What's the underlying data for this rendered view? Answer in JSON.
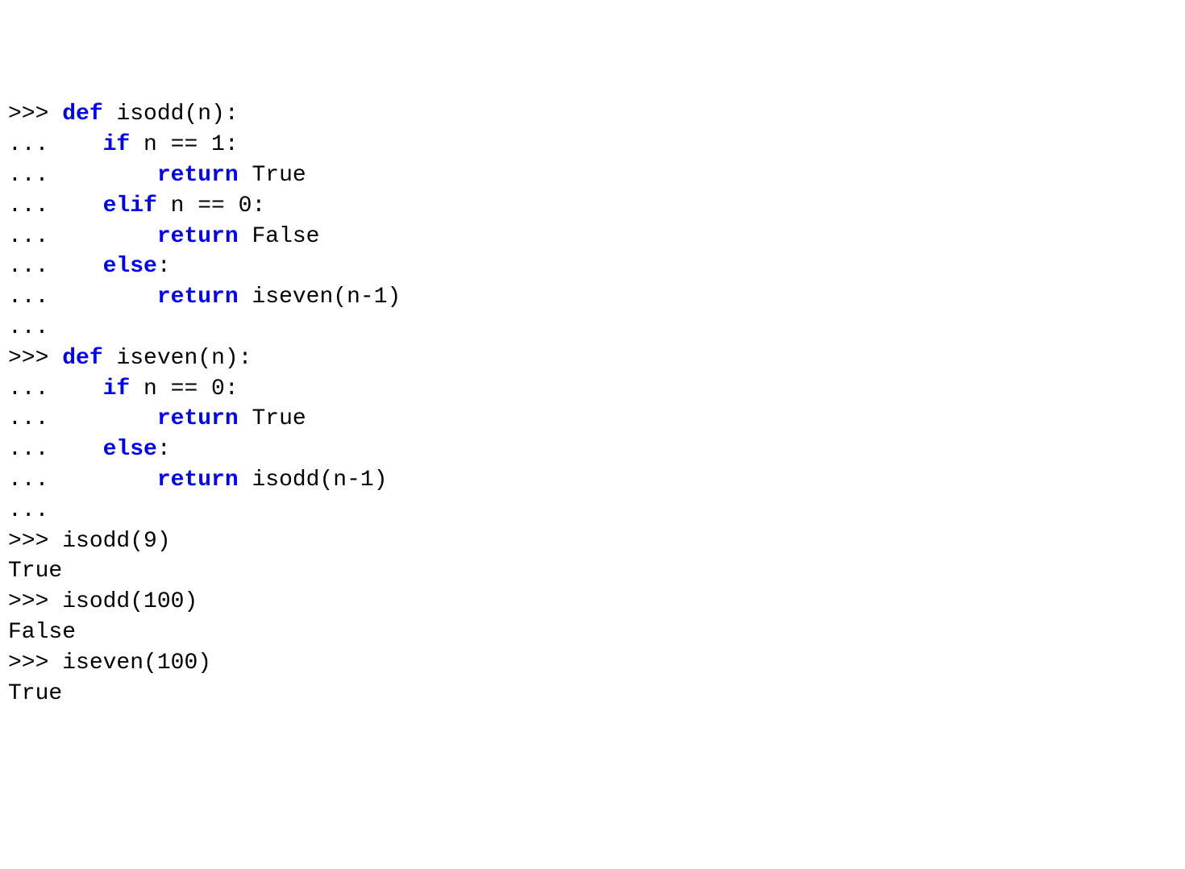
{
  "lines": [
    {
      "segments": [
        {
          "text": ">>> ",
          "cls": "prompt"
        },
        {
          "text": "def",
          "cls": "keyword"
        },
        {
          "text": " isodd(n):"
        }
      ]
    },
    {
      "segments": [
        {
          "text": "...    ",
          "cls": "prompt"
        },
        {
          "text": "if",
          "cls": "keyword"
        },
        {
          "text": " n == 1:"
        }
      ]
    },
    {
      "segments": [
        {
          "text": "...        ",
          "cls": "prompt"
        },
        {
          "text": "return",
          "cls": "keyword"
        },
        {
          "text": " True"
        }
      ]
    },
    {
      "segments": [
        {
          "text": "...    ",
          "cls": "prompt"
        },
        {
          "text": "elif",
          "cls": "keyword"
        },
        {
          "text": " n == 0:"
        }
      ]
    },
    {
      "segments": [
        {
          "text": "...        ",
          "cls": "prompt"
        },
        {
          "text": "return",
          "cls": "keyword"
        },
        {
          "text": " False"
        }
      ]
    },
    {
      "segments": [
        {
          "text": "...    ",
          "cls": "prompt"
        },
        {
          "text": "else",
          "cls": "keyword"
        },
        {
          "text": ":"
        }
      ]
    },
    {
      "segments": [
        {
          "text": "...        ",
          "cls": "prompt"
        },
        {
          "text": "return",
          "cls": "keyword"
        },
        {
          "text": " iseven(n-1)"
        }
      ]
    },
    {
      "segments": [
        {
          "text": "...",
          "cls": "prompt"
        }
      ]
    },
    {
      "segments": [
        {
          "text": ">>> ",
          "cls": "prompt"
        },
        {
          "text": "def",
          "cls": "keyword"
        },
        {
          "text": " iseven(n):"
        }
      ]
    },
    {
      "segments": [
        {
          "text": "...    ",
          "cls": "prompt"
        },
        {
          "text": "if",
          "cls": "keyword"
        },
        {
          "text": " n == 0:"
        }
      ]
    },
    {
      "segments": [
        {
          "text": "...        ",
          "cls": "prompt"
        },
        {
          "text": "return",
          "cls": "keyword"
        },
        {
          "text": " True"
        }
      ]
    },
    {
      "segments": [
        {
          "text": "...    ",
          "cls": "prompt"
        },
        {
          "text": "else",
          "cls": "keyword"
        },
        {
          "text": ":"
        }
      ]
    },
    {
      "segments": [
        {
          "text": "...        ",
          "cls": "prompt"
        },
        {
          "text": "return",
          "cls": "keyword"
        },
        {
          "text": " isodd(n-1)"
        }
      ]
    },
    {
      "segments": [
        {
          "text": "...",
          "cls": "prompt"
        }
      ]
    },
    {
      "segments": [
        {
          "text": ">>> ",
          "cls": "prompt"
        },
        {
          "text": "isodd(9)"
        }
      ]
    },
    {
      "segments": [
        {
          "text": "True"
        }
      ]
    },
    {
      "segments": [
        {
          "text": ">>> ",
          "cls": "prompt"
        },
        {
          "text": "isodd(100)"
        }
      ]
    },
    {
      "segments": [
        {
          "text": "False"
        }
      ]
    },
    {
      "segments": [
        {
          "text": ">>> ",
          "cls": "prompt"
        },
        {
          "text": "iseven(100)"
        }
      ]
    },
    {
      "segments": [
        {
          "text": "True"
        }
      ]
    }
  ]
}
